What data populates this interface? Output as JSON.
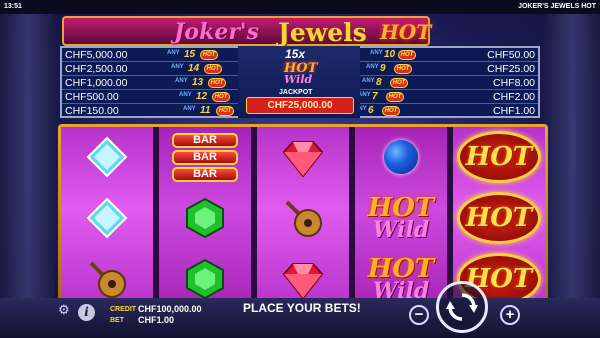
{
  "top_bar": {
    "clock": "13:51",
    "game_name": "JOKER'S JEWELS HOT"
  },
  "title": {
    "part1": "Joker's",
    "part2": "Jewels",
    "part3": "HOT"
  },
  "paytable": {
    "any_label": "ANY",
    "hot_label": "HOT",
    "left_rows": [
      {
        "amount": "CHF5,000.00",
        "count": "15"
      },
      {
        "amount": "CHF2,500.00",
        "count": "14"
      },
      {
        "amount": "CHF1,000.00",
        "count": "13"
      },
      {
        "amount": "CHF500.00",
        "count": "12"
      },
      {
        "amount": "CHF150.00",
        "count": "11"
      }
    ],
    "right_rows": [
      {
        "amount": "CHF50.00",
        "count": "10"
      },
      {
        "amount": "CHF25.00",
        "count": "9"
      },
      {
        "amount": "CHF8.00",
        "count": "8"
      },
      {
        "amount": "CHF2.00",
        "count": "7"
      },
      {
        "amount": "CHF1.00",
        "count": "6"
      }
    ]
  },
  "jackpot": {
    "multiplier": "15x",
    "hot_text": "HOT",
    "wild_text": "Wild",
    "label": "JACKPOT",
    "value": "CHF25,000.00"
  },
  "symbol_text": {
    "bar": "BAR",
    "hot": "HOT",
    "wild": "Wild"
  },
  "reels": [
    [
      "blue-diamond",
      "blue-diamond",
      "lute"
    ],
    [
      "triple-bar",
      "green-gem",
      "green-gem"
    ],
    [
      "red-gem",
      "lute",
      "red-gem"
    ],
    [
      "sapphire",
      "hot-wild",
      "hot-wild"
    ],
    [
      "hot",
      "hot",
      "hot"
    ]
  ],
  "bottom_bar": {
    "credit_label": "CREDIT",
    "credit_value": "CHF100,000.00",
    "bet_label": "BET",
    "bet_value": "CHF1.00",
    "message": "PLACE YOUR BETS!",
    "minus_label": "−",
    "plus_label": "+",
    "settings_icon": "gear-icon",
    "info_icon": "info-icon",
    "info_glyph": "i",
    "spin_icon": "spin-icon"
  },
  "colors": {
    "reel_purple": "#e05cf0",
    "frame_gold": "#e7a52f",
    "paytable_navy": "#0c1a55",
    "jackpot_red": "#d6201a"
  }
}
